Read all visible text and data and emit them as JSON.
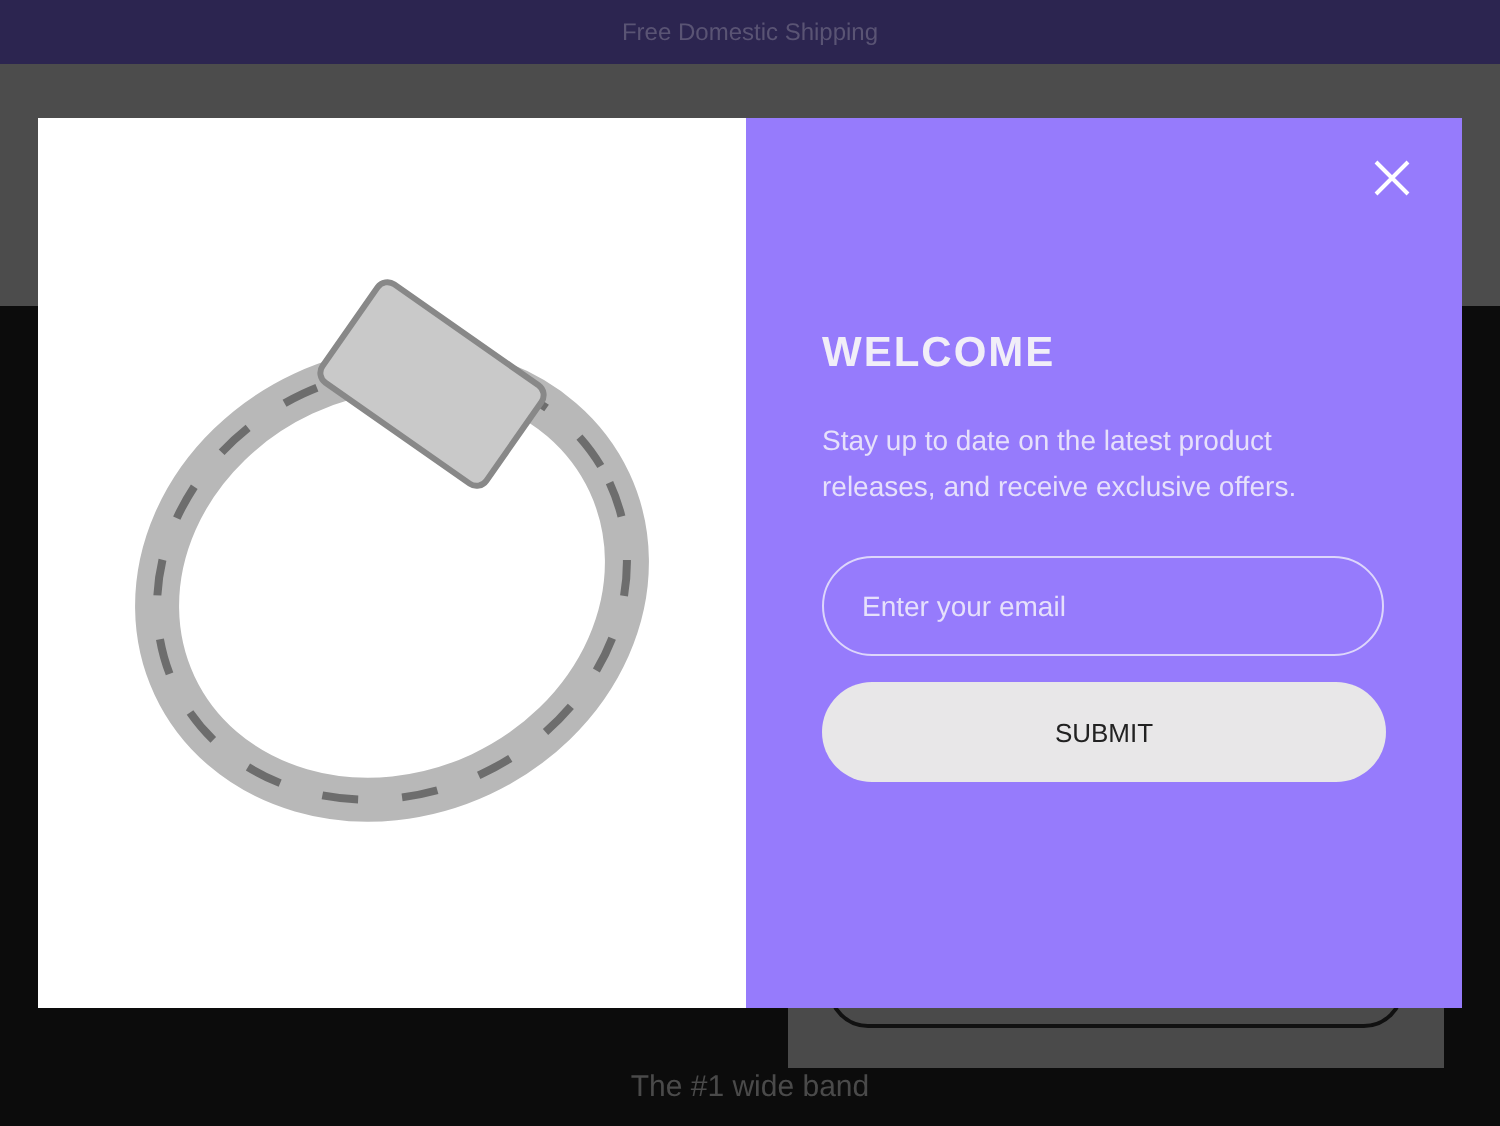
{
  "announcement_bar": {
    "text": "Free Domestic Shipping"
  },
  "hero": {
    "caption": "The #1 wide band"
  },
  "popup": {
    "title": "WELCOME",
    "message": "Stay up to date on the latest product releases, and receive exclusive offers.",
    "email_field": {
      "placeholder": "Enter your email"
    },
    "submit_button": {
      "label": "SUBMIT"
    }
  }
}
